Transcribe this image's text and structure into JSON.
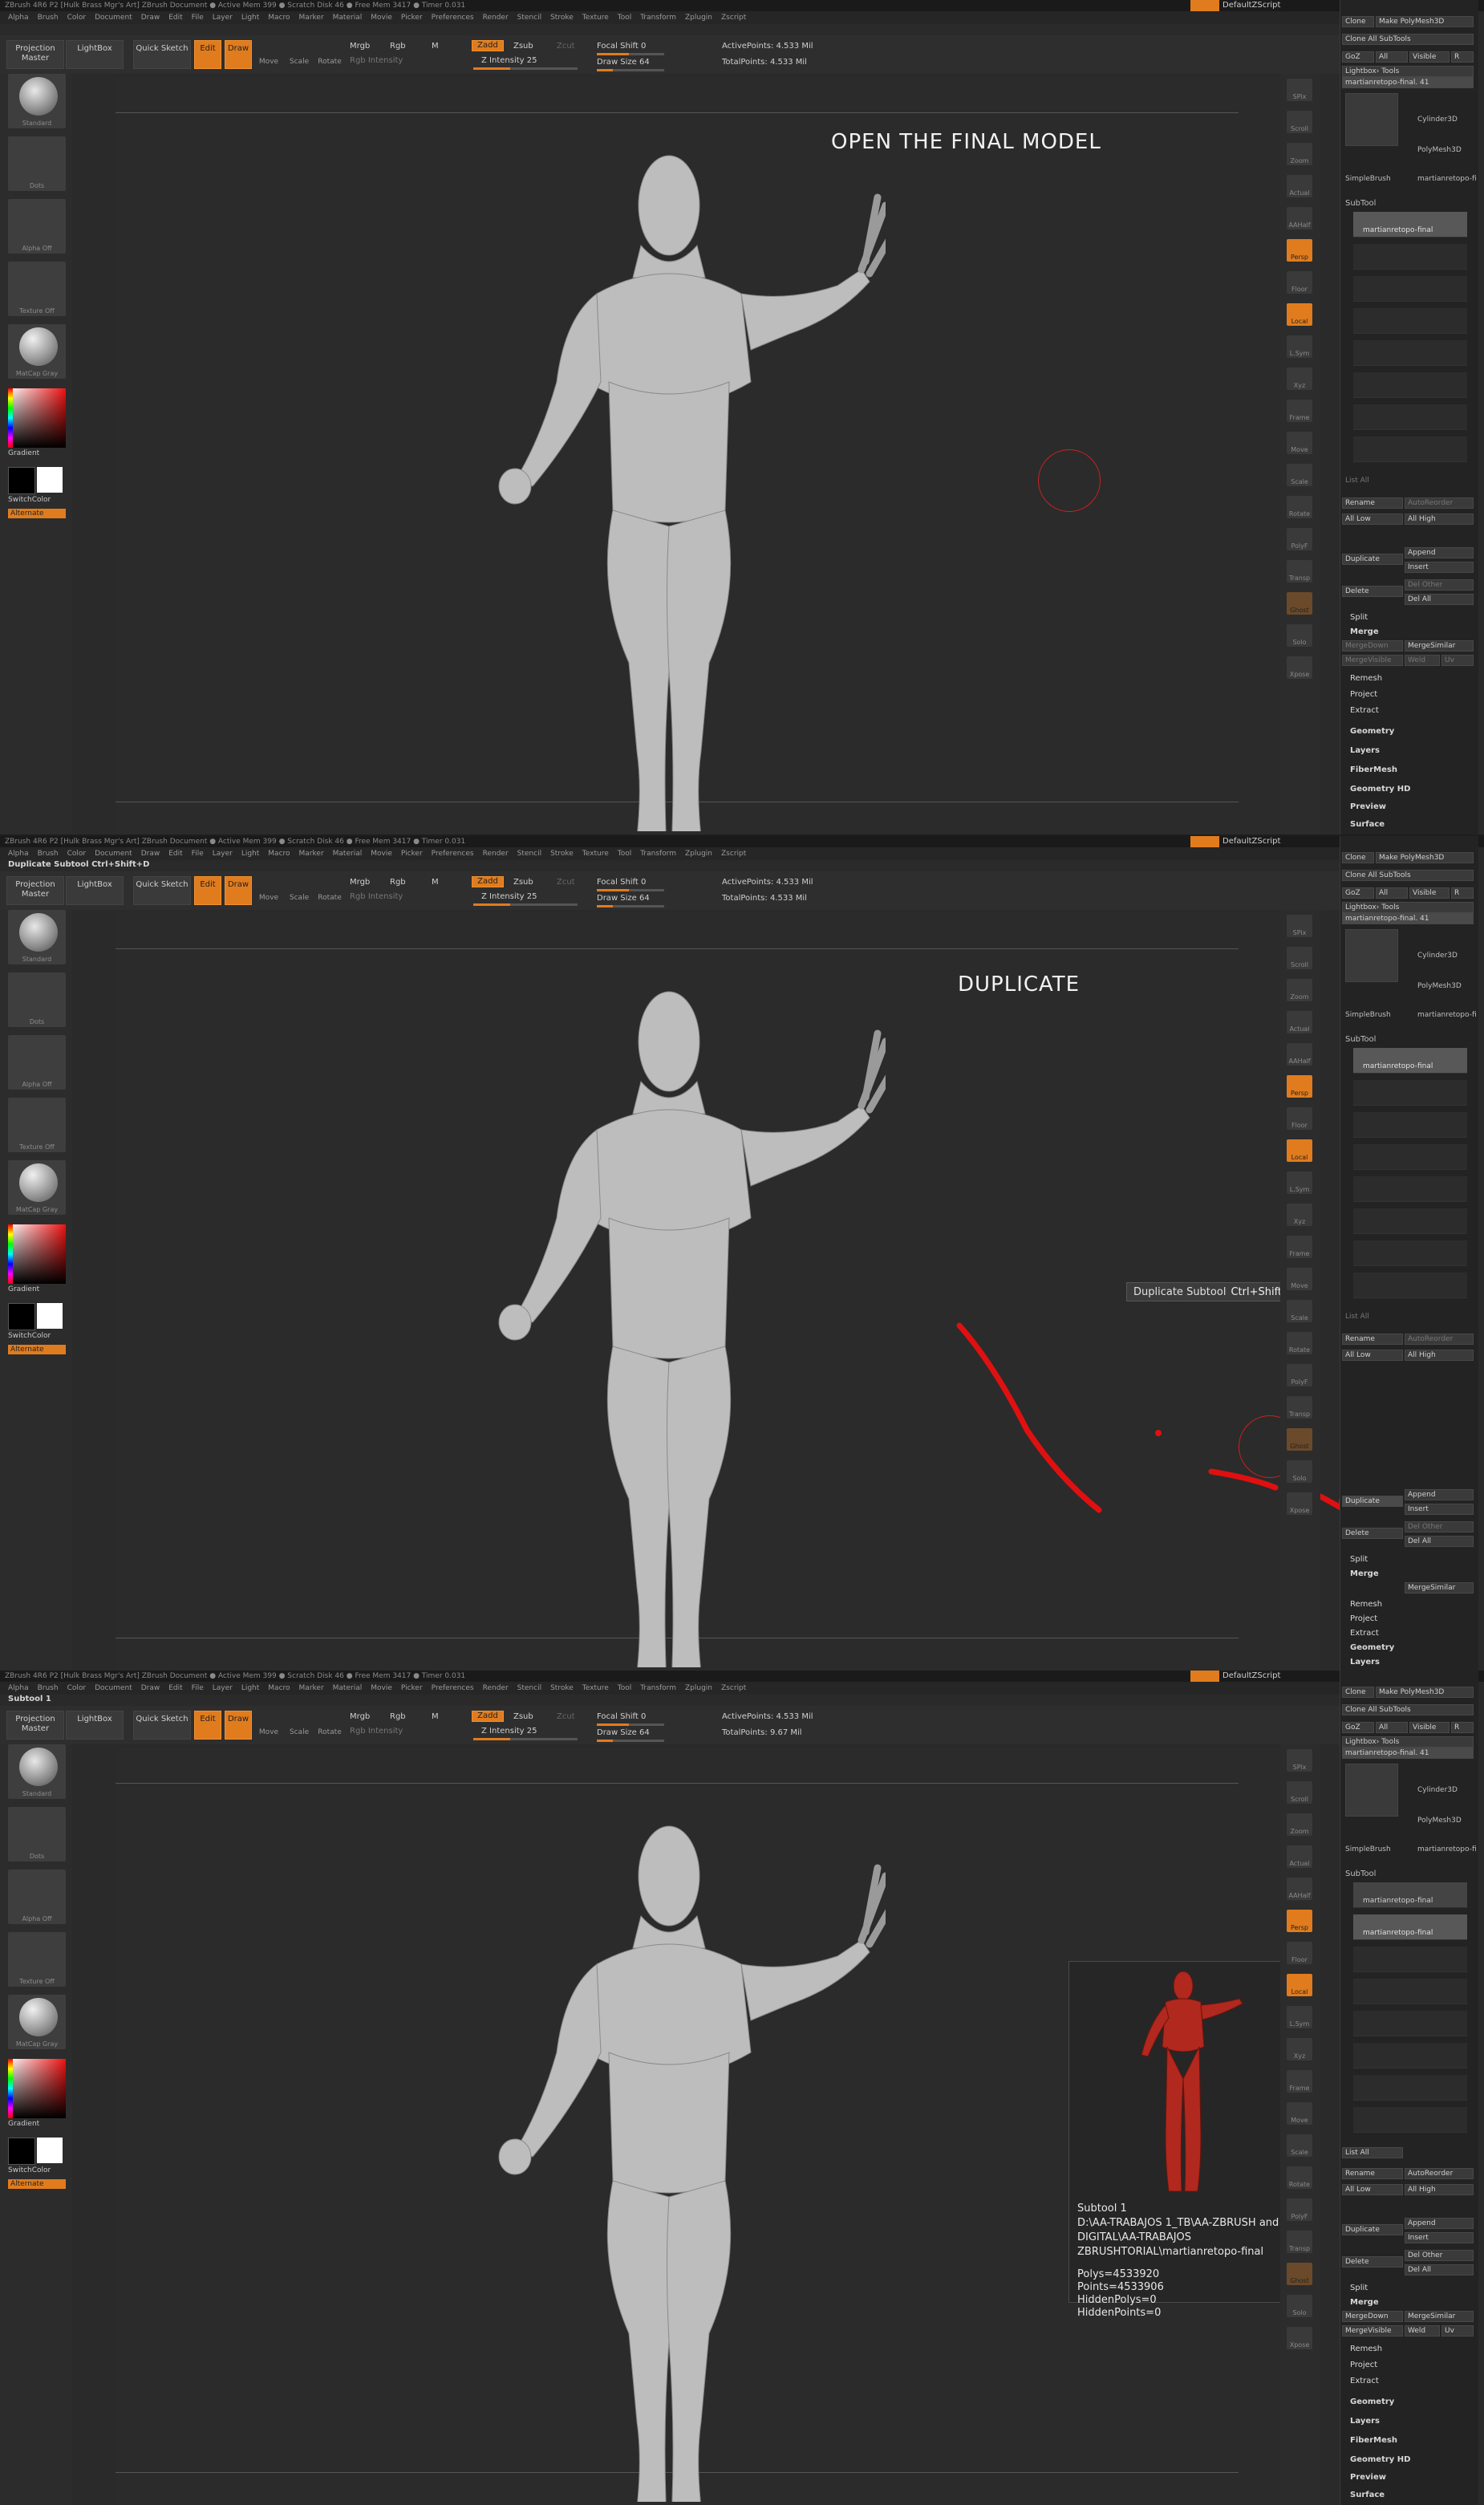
{
  "app": {
    "title_text": "ZBrush 4R6 P2 [Hulk Brass Mgr's Art] ZBrush Document  ● Active Mem 399 ● Scratch Disk 46 ● Free Mem 3417 ● Timer 0.031",
    "script_label": "DefaultZScript",
    "brand_color": "#e07c1e"
  },
  "menu": [
    "Alpha",
    "Brush",
    "Color",
    "Document",
    "Draw",
    "Edit",
    "File",
    "Layer",
    "Light",
    "Macro",
    "Marker",
    "Material",
    "Movie",
    "Picker",
    "Preferences",
    "Render",
    "Stencil",
    "Stroke",
    "Texture",
    "Tool",
    "Transform",
    "Zplugin",
    "Zscript"
  ],
  "toolbar": {
    "projection_master": "Projection Master",
    "lightbox": "LightBox",
    "quick_sketch": "Quick Sketch",
    "edit": "Edit",
    "draw": "Draw",
    "move": "Move",
    "scale": "Scale",
    "rotate": "Rotate",
    "mrgb": "Mrgb",
    "rgb": "Rgb",
    "m": "M",
    "rgb_intensity": "Rgb Intensity",
    "zadd": "Zadd",
    "zsub": "Zsub",
    "zcut": "Zcut",
    "z_intensity": "Z Intensity 25",
    "focal_shift": "Focal Shift 0",
    "draw_size": "Draw Size 64",
    "active_points": "ActivePoints: 4.533 Mil",
    "total_points_1": "TotalPoints: 4.533 Mil",
    "total_points_3": "TotalPoints: 9.67 Mil"
  },
  "lefttray": {
    "standard": "Standard",
    "dots": "Dots",
    "alpha_off": "Alpha Off",
    "texture_off": "Texture Off",
    "matcap": "MatCap Gray",
    "gradient": "Gradient",
    "switchcolor": "SwitchColor",
    "alternate": "Alternate"
  },
  "righttray": [
    "SPix",
    "Scroll",
    "Zoom",
    "Actual",
    "AAHalf",
    "Persp",
    "Floor",
    "Local",
    "L.Sym",
    "Xyz",
    "Frame",
    "Move",
    "Scale",
    "Rotate",
    "PolyF",
    "Transp",
    "Ghost",
    "Solo",
    "Xpose"
  ],
  "sidepanel": {
    "clone": "Clone",
    "make_polymesh": "Make PolyMesh3D",
    "goz": "GoZ",
    "all": "All",
    "visible": "Visible",
    "r": "R",
    "clone_all": "Clone All SubTools",
    "lightbox_tools": "Lightbox› Tools",
    "tool_name": "martianretopo-final. 41",
    "cylinder": "Cylinder3D",
    "polymesh": "PolyMesh3D",
    "simplebrush": "SimpleBrush",
    "martian_short": "martianretopo-fi",
    "subtool": "SubTool",
    "subtool_item": "martianretopo-final",
    "subtool_item_copy": "martianretopo-final",
    "list_all": "List All",
    "rename": "Rename",
    "autoreorder": "AutoReorder",
    "all_low": "All Low",
    "all_high": "All High",
    "duplicate": "Duplicate",
    "append": "Append",
    "insert": "Insert",
    "delete": "Delete",
    "del_other": "Del Other",
    "del_all": "Del All",
    "split": "Split",
    "merge": "Merge",
    "mergedown": "MergeDown",
    "mergesimilar": "MergeSimilar",
    "mergevisible": "MergeVisible",
    "weld": "Weld",
    "uv": "Uv",
    "remesh": "Remesh",
    "project": "Project",
    "extract": "Extract",
    "geometry": "Geometry",
    "layers": "Layers",
    "fibermesh": "FiberMesh",
    "geometry_hd": "Geometry HD",
    "preview": "Preview",
    "surface": "Surface"
  },
  "steps": [
    {
      "caption": "OPEN THE FINAL MODEL",
      "hint": ""
    },
    {
      "caption": "DUPLICATE",
      "hint": "Duplicate Subtool  Ctrl+Shift+D"
    },
    {
      "caption": "",
      "hint": "Subtool 1"
    }
  ],
  "tooltip": {
    "label": "Duplicate Subtool",
    "shortcut": "Ctrl+Shift+D"
  },
  "infocard": {
    "title": "Subtool 1",
    "path_line1": "D:\\AA-TRABAJOS 1_TB\\AA-ZBRUSH  and",
    "path_line2": "DIGITAL\\AA-TRABAJOS",
    "path_line3": "ZBRUSHTORIAL\\martianretopo-final",
    "polys": "Polys=4533920",
    "points": "Points=4533906",
    "hidden_polys": "HiddenPolys=0",
    "hidden_points": "HiddenPoints=0"
  },
  "colors": {
    "annotation_red": "#e01010",
    "model_gray": "#bdbdbd",
    "model_red": "#b0281e"
  }
}
